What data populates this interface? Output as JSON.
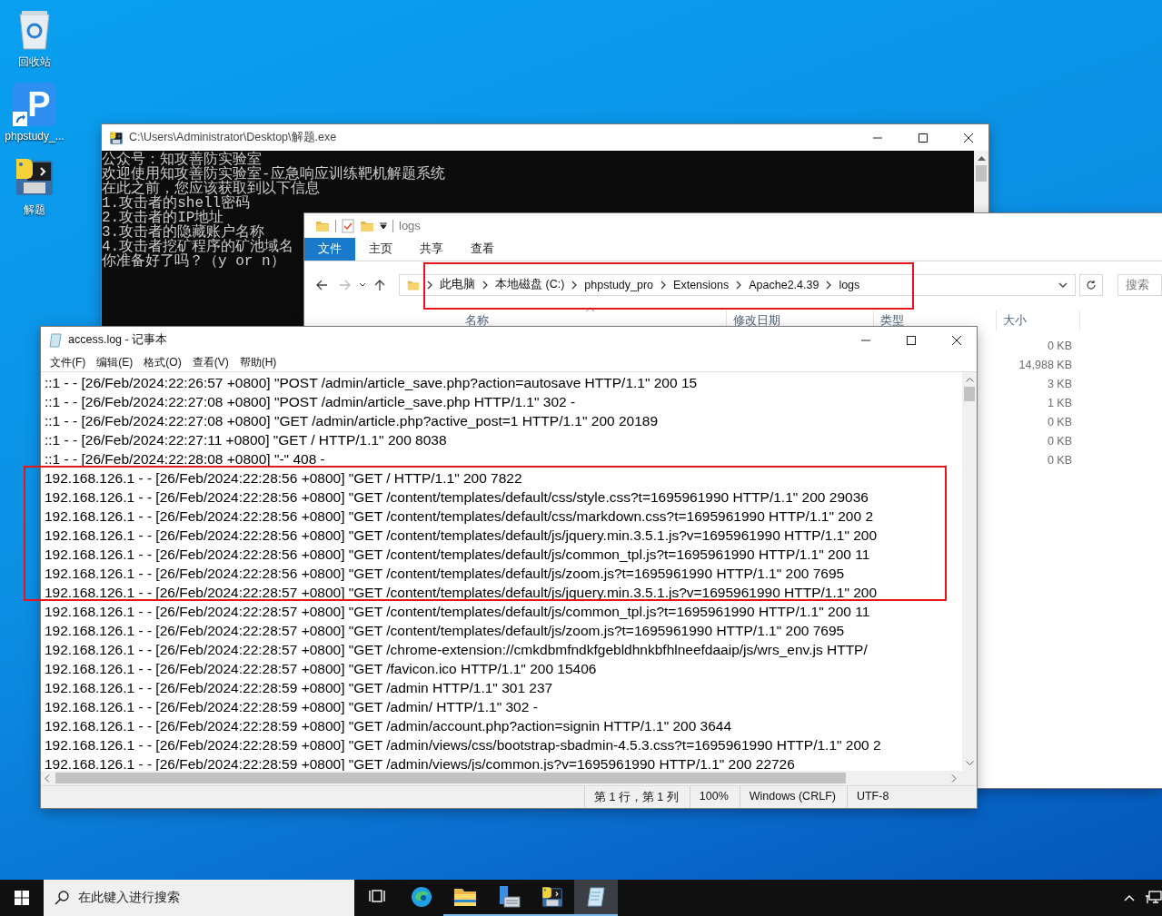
{
  "desktop": {
    "icons": [
      {
        "kind": "recycle",
        "label": "回收站"
      },
      {
        "kind": "shortcut",
        "glyph": "P",
        "label": "phpstudy_..."
      },
      {
        "kind": "python",
        "label": "解题"
      }
    ]
  },
  "console": {
    "title": "C:\\Users\\Administrator\\Desktop\\解题.exe",
    "lines": [
      "公众号：知攻善防实验室",
      "欢迎使用知攻善防实验室-应急响应训练靶机解题系统",
      "在此之前，您应该获取到以下信息",
      "1.攻击者的shell密码",
      "2.攻击者的IP地址",
      "3.攻击者的隐藏账户名称",
      "4.攻击者挖矿程序的矿池域名",
      "你准备好了吗？（y or n）"
    ]
  },
  "explorer": {
    "title": "logs",
    "tabs": [
      {
        "label": "文件",
        "selected": true
      },
      {
        "label": "主页",
        "selected": false
      },
      {
        "label": "共享",
        "selected": false
      },
      {
        "label": "查看",
        "selected": false
      }
    ],
    "breadcrumb": [
      "此电脑",
      "本地磁盘 (C:)",
      "phpstudy_pro",
      "Extensions",
      "Apache2.4.39",
      "logs"
    ],
    "search": {
      "placeholder": "搜索"
    },
    "columns": [
      "名称",
      "修改日期",
      "类型",
      "大小"
    ],
    "sizes": [
      "0 KB",
      "14,988 KB",
      "3 KB",
      "1 KB",
      "0 KB",
      "0 KB",
      "0 KB"
    ]
  },
  "notepad": {
    "title": "access.log - 记事本",
    "menu": [
      "文件(F)",
      "编辑(E)",
      "格式(O)",
      "查看(V)",
      "帮助(H)"
    ],
    "lines": [
      "::1 - - [26/Feb/2024:22:26:57 +0800] \"POST /admin/article_save.php?action=autosave HTTP/1.1\" 200 15",
      "::1 - - [26/Feb/2024:22:27:08 +0800] \"POST /admin/article_save.php HTTP/1.1\" 302 -",
      "::1 - - [26/Feb/2024:22:27:08 +0800] \"GET /admin/article.php?active_post=1 HTTP/1.1\" 200 20189",
      "::1 - - [26/Feb/2024:22:27:11 +0800] \"GET / HTTP/1.1\" 200 8038",
      "::1 - - [26/Feb/2024:22:28:08 +0800] \"-\" 408 -",
      "192.168.126.1 - - [26/Feb/2024:22:28:56 +0800] \"GET / HTTP/1.1\" 200 7822",
      "192.168.126.1 - - [26/Feb/2024:22:28:56 +0800] \"GET /content/templates/default/css/style.css?t=1695961990 HTTP/1.1\" 200 29036",
      "192.168.126.1 - - [26/Feb/2024:22:28:56 +0800] \"GET /content/templates/default/css/markdown.css?t=1695961990 HTTP/1.1\" 200 2",
      "192.168.126.1 - - [26/Feb/2024:22:28:56 +0800] \"GET /content/templates/default/js/jquery.min.3.5.1.js?v=1695961990 HTTP/1.1\" 200",
      "192.168.126.1 - - [26/Feb/2024:22:28:56 +0800] \"GET /content/templates/default/js/common_tpl.js?t=1695961990 HTTP/1.1\" 200 11",
      "192.168.126.1 - - [26/Feb/2024:22:28:56 +0800] \"GET /content/templates/default/js/zoom.js?t=1695961990 HTTP/1.1\" 200 7695",
      "192.168.126.1 - - [26/Feb/2024:22:28:57 +0800] \"GET /content/templates/default/js/jquery.min.3.5.1.js?v=1695961990 HTTP/1.1\" 200",
      "192.168.126.1 - - [26/Feb/2024:22:28:57 +0800] \"GET /content/templates/default/js/common_tpl.js?t=1695961990 HTTP/1.1\" 200 11",
      "192.168.126.1 - - [26/Feb/2024:22:28:57 +0800] \"GET /content/templates/default/js/zoom.js?t=1695961990 HTTP/1.1\" 200 7695",
      "192.168.126.1 - - [26/Feb/2024:22:28:57 +0800] \"GET /chrome-extension://cmkdbmfndkfgebldhnkbfhlneefdaaip/js/wrs_env.js HTTP/",
      "192.168.126.1 - - [26/Feb/2024:22:28:57 +0800] \"GET /favicon.ico HTTP/1.1\" 200 15406",
      "192.168.126.1 - - [26/Feb/2024:22:28:59 +0800] \"GET /admin HTTP/1.1\" 301 237",
      "192.168.126.1 - - [26/Feb/2024:22:28:59 +0800] \"GET /admin/ HTTP/1.1\" 302 -",
      "192.168.126.1 - - [26/Feb/2024:22:28:59 +0800] \"GET /admin/account.php?action=signin HTTP/1.1\" 200 3644",
      "192.168.126.1 - - [26/Feb/2024:22:28:59 +0800] \"GET /admin/views/css/bootstrap-sbadmin-4.5.3.css?t=1695961990 HTTP/1.1\" 200 2",
      "192.168.126.1 - - [26/Feb/2024:22:28:59 +0800] \"GET /admin/views/js/common.js?v=1695961990 HTTP/1.1\" 200 22726"
    ],
    "status": [
      "第 1 行，第 1 列",
      "100%",
      "Windows (CRLF)",
      "UTF-8"
    ]
  },
  "taskbar": {
    "search": {
      "placeholder": "在此键入进行搜索"
    },
    "apps": [
      {
        "kind": "taskview",
        "running": false,
        "active": false
      },
      {
        "kind": "edge",
        "running": false,
        "active": false
      },
      {
        "kind": "explorer",
        "running": true,
        "active": false
      },
      {
        "kind": "server",
        "running": true,
        "active": false
      },
      {
        "kind": "python",
        "running": true,
        "active": false
      },
      {
        "kind": "notepad",
        "running": true,
        "active": true
      }
    ]
  }
}
